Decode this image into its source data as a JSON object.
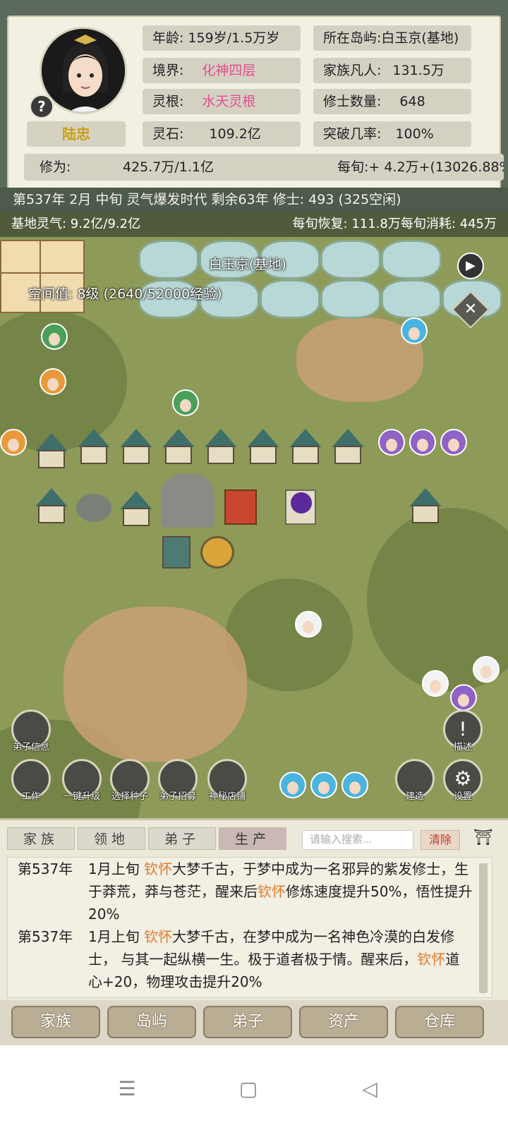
{
  "character": {
    "name": "陆忠",
    "age_label": "年龄:",
    "age_value": "159岁/1.5万岁",
    "realm_label": "境界:",
    "realm_value": "化神四层",
    "root_label": "灵根:",
    "root_value": "水天灵根",
    "stone_label": "灵石:",
    "stone_value": "109.2亿",
    "island_label": "所在岛屿:",
    "island_value": "白玉京(基地)",
    "mortals_label": "家族凡人:",
    "mortals_value": "131.5万",
    "cultivators_label": "修士数量:",
    "cultivators_value": "648",
    "breakthrough_label": "突破几率:",
    "breakthrough_value": "100%",
    "cultivation_label": "修为:",
    "cultivation_value": "425.7万/1.1亿",
    "per_xun_label": "每旬:",
    "per_xun_value": "+ 4.2万+(13026.88%"
  },
  "status_line": "第537年 2月 中旬  灵气爆发时代 剩余63年  修士: 493 (325空闲)",
  "map": {
    "base_qi": "基地灵气: 9.2亿/9.2亿",
    "recovery": "每旬恢复: 111.8万每旬消耗: 445万",
    "location_name": "白玉京(基地)",
    "space_value": "空间值: 8级 (2640/52000经验)",
    "buttons": {
      "disciple_info": "弟子信息",
      "work": "工作",
      "upgrade": "一键升级",
      "seeds": "选择种子",
      "recruit": "弟子招募",
      "shop": "神秘店铺",
      "build": "建造",
      "settings": "设置",
      "describe": "描述"
    }
  },
  "tabs": [
    "家族",
    "领地",
    "弟子",
    "生产"
  ],
  "search": {
    "placeholder": "请输入搜索...",
    "clear": "清除"
  },
  "log": [
    {
      "year": "第537年",
      "prefix": "1月上旬 ",
      "name1": "钦怀",
      "mid": "大梦千古，于梦中成为一名邪异的紫发修士，生于莽荒，莽与苍茫，醒来后",
      "name2": "钦怀",
      "end": "修炼速度提升50%，悟性提升20%"
    },
    {
      "year": "第537年",
      "prefix": "1月上旬 ",
      "name1": "钦怀",
      "mid": "大梦千古，在梦中成为一名神色冷漠的白发修士， 与其一起纵横一生。极于道者极于情。醒来后，",
      "name2": "钦怀",
      "end": "道心+20，物理攻击提升20%"
    }
  ],
  "nav": [
    "家族",
    "岛屿",
    "弟子",
    "资产",
    "仓库"
  ],
  "system_icons": [
    "menu-icon",
    "home-icon",
    "back-icon"
  ],
  "colors": {
    "realm": "#e0508f",
    "highlight_name": "#e07a2b",
    "name_gold": "#c9a013"
  }
}
